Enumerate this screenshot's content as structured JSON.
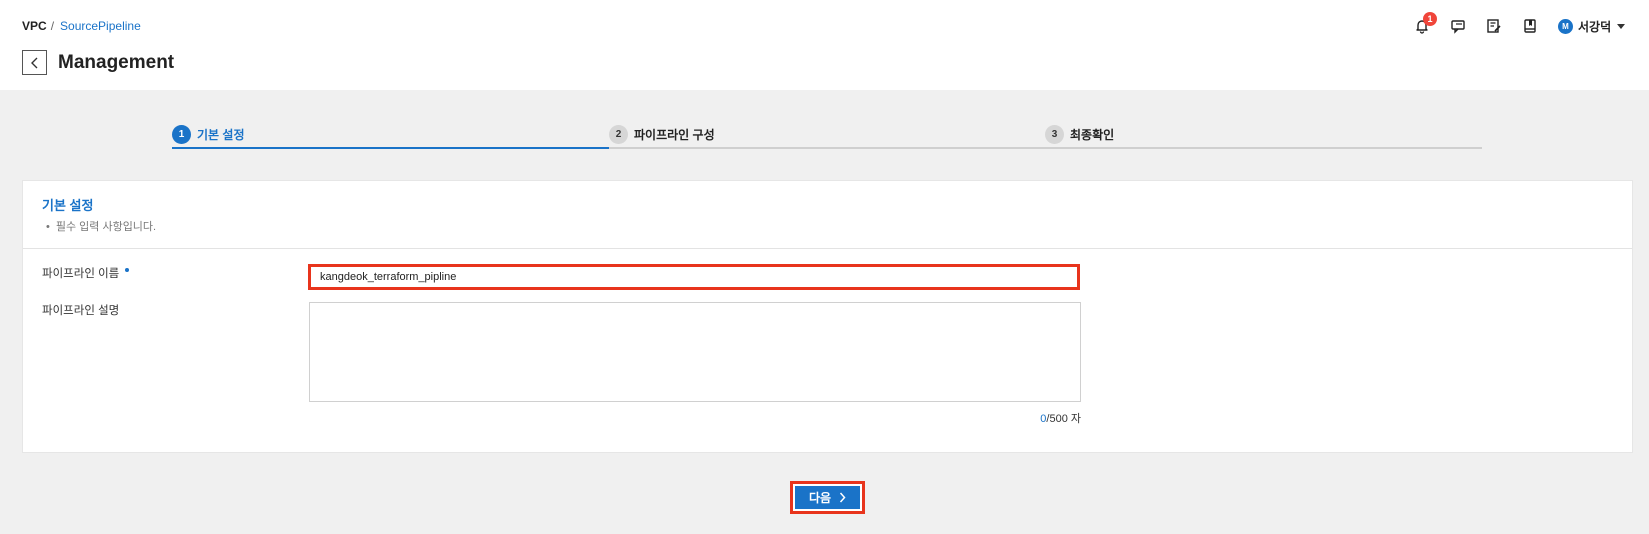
{
  "breadcrumb": {
    "root": "VPC",
    "separator": "/",
    "current": "SourcePipeline"
  },
  "page": {
    "title": "Management"
  },
  "header": {
    "notifications": {
      "count": "1"
    },
    "user": {
      "avatar_initial": "M",
      "name": "서강덕"
    },
    "icons": [
      "bell-icon",
      "chat-icon",
      "edit-note-icon",
      "book-icon"
    ]
  },
  "steps": [
    {
      "number": "1",
      "label": "기본 설정",
      "state": "active"
    },
    {
      "number": "2",
      "label": "파이프라인 구성",
      "state": "inactive"
    },
    {
      "number": "3",
      "label": "최종확인",
      "state": "inactive"
    }
  ],
  "form": {
    "section_title": "기본 설정",
    "section_note": "필수 입력 사항입니다.",
    "name": {
      "label": "파이프라인 이름",
      "value": "kangdeok_terraform_pipline",
      "required": true
    },
    "description": {
      "label": "파이프라인 설명",
      "value": "",
      "count": "0",
      "limit": "/500 자"
    }
  },
  "actions": {
    "next_label": "다음"
  },
  "colors": {
    "accent": "#1a73c8",
    "highlight": "#e8341c",
    "badge": "#f0453a",
    "background": "#f0f0f0"
  }
}
